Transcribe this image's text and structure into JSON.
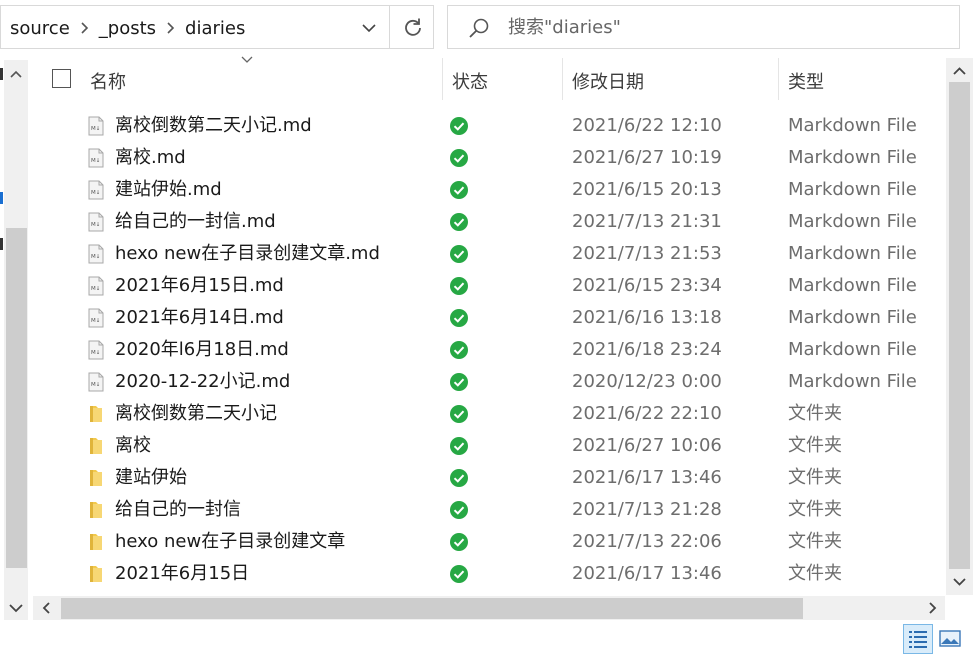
{
  "address": {
    "crumbs": [
      "source",
      "_posts",
      "diaries"
    ]
  },
  "search": {
    "placeholder": "搜索\"diaries\""
  },
  "columns": {
    "name": "名称",
    "status": "状态",
    "date": "修改日期",
    "type": "类型"
  },
  "rows": [
    {
      "name": "离校倒数第二天小记.md",
      "date": "2021/6/22 12:10",
      "type": "Markdown File",
      "kind": "md"
    },
    {
      "name": "离校.md",
      "date": "2021/6/27 10:19",
      "type": "Markdown File",
      "kind": "md"
    },
    {
      "name": "建站伊始.md",
      "date": "2021/6/15 20:13",
      "type": "Markdown File",
      "kind": "md"
    },
    {
      "name": "给自己的一封信.md",
      "date": "2021/7/13 21:31",
      "type": "Markdown File",
      "kind": "md"
    },
    {
      "name": "hexo new在子目录创建文章.md",
      "date": "2021/7/13 21:53",
      "type": "Markdown File",
      "kind": "md"
    },
    {
      "name": "2021年6月15日.md",
      "date": "2021/6/15 23:34",
      "type": "Markdown File",
      "kind": "md"
    },
    {
      "name": "2021年6月14日.md",
      "date": "2021/6/16 13:18",
      "type": "Markdown File",
      "kind": "md"
    },
    {
      "name": "2020年l6月18日.md",
      "date": "2021/6/18 23:24",
      "type": "Markdown File",
      "kind": "md"
    },
    {
      "name": "2020-12-22小记.md",
      "date": "2020/12/23 0:00",
      "type": "Markdown File",
      "kind": "md"
    },
    {
      "name": "离校倒数第二天小记",
      "date": "2021/6/22 22:10",
      "type": "文件夹",
      "kind": "folder"
    },
    {
      "name": "离校",
      "date": "2021/6/27 10:06",
      "type": "文件夹",
      "kind": "folder"
    },
    {
      "name": "建站伊始",
      "date": "2021/6/17 13:46",
      "type": "文件夹",
      "kind": "folder"
    },
    {
      "name": "给自己的一封信",
      "date": "2021/7/13 21:28",
      "type": "文件夹",
      "kind": "folder"
    },
    {
      "name": "hexo new在子目录创建文章",
      "date": "2021/7/13 22:06",
      "type": "文件夹",
      "kind": "folder"
    },
    {
      "name": "2021年6月15日",
      "date": "2021/6/17 13:46",
      "type": "文件夹",
      "kind": "folder"
    }
  ],
  "icons": {
    "md": "markdown-file-icon",
    "folder": "folder-icon",
    "status": "sync-ok-icon"
  },
  "colors": {
    "status_green": "#27a844",
    "folder_yellow": "#f2c94c",
    "selection_blue": "#d9ecfa"
  }
}
